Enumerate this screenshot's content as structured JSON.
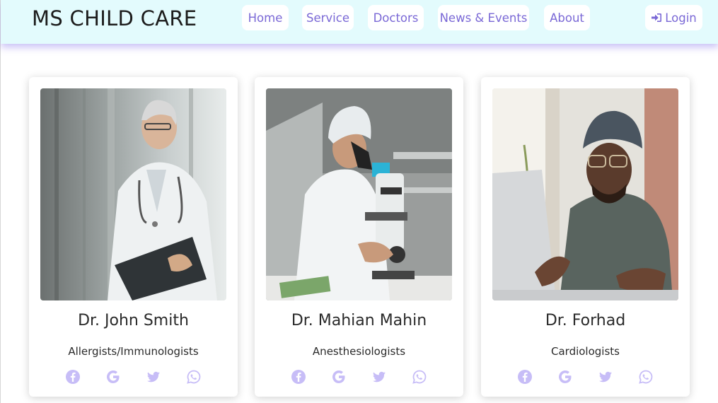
{
  "nav": {
    "brand": "MS CHILD CARE",
    "links": [
      "Home",
      "Service",
      "Doctors",
      "News & Events",
      "About"
    ],
    "login": "Login"
  },
  "doctors": [
    {
      "name": "Dr. John Smith",
      "specialty": "Allergists/Immunologists"
    },
    {
      "name": "Dr. Mahian Mahin",
      "specialty": "Anesthesiologists"
    },
    {
      "name": "Dr. Forhad",
      "specialty": "Cardiologists"
    }
  ],
  "colors": {
    "accent": "#7a68d6",
    "social_icon": "#c7bdf7",
    "navbar_bg": "#e3fbfd"
  },
  "icons": [
    "login-icon",
    "facebook-icon",
    "google-icon",
    "twitter-icon",
    "whatsapp-icon"
  ]
}
